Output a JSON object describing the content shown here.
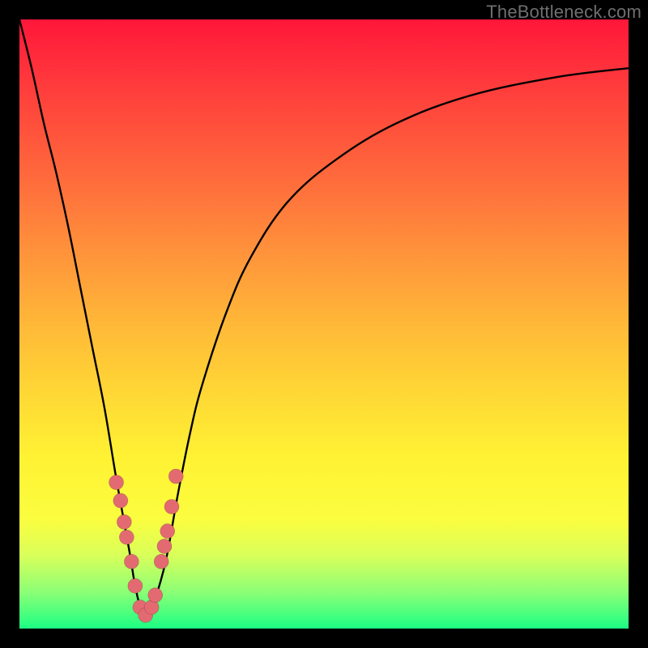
{
  "watermark": "TheBottleneck.com",
  "colors": {
    "frame": "#000000",
    "curve": "#000000",
    "marker": "#e46a72",
    "gradient_top": "#ff163a",
    "gradient_bottom": "#1cff83"
  },
  "chart_data": {
    "type": "line",
    "title": "",
    "xlabel": "",
    "ylabel": "",
    "xlim": [
      0,
      100
    ],
    "ylim": [
      0,
      100
    ],
    "grid": false,
    "series": [
      {
        "name": "curve",
        "x": [
          0,
          2,
          4,
          6,
          8,
          10,
          12,
          14,
          16,
          18,
          19,
          20,
          21,
          22,
          24,
          26,
          28,
          30,
          34,
          38,
          44,
          52,
          62,
          74,
          88,
          100
        ],
        "values": [
          100,
          92,
          83,
          75,
          66,
          56,
          46,
          36,
          24,
          13,
          7,
          3,
          2,
          4,
          11,
          22,
          32,
          40,
          52,
          61,
          70,
          77,
          83,
          87.5,
          90.5,
          92
        ]
      }
    ],
    "markers": {
      "name": "highlighted-points",
      "x": [
        15.9,
        16.6,
        17.2,
        17.6,
        18.4,
        19.0,
        19.8,
        20.7,
        21.7,
        22.3,
        23.3,
        23.8,
        24.3,
        25.0,
        25.7
      ],
      "values": [
        24,
        21,
        17.5,
        15,
        11,
        7,
        3.5,
        2.2,
        3.5,
        5.5,
        11,
        13.5,
        16,
        20,
        25
      ]
    }
  }
}
